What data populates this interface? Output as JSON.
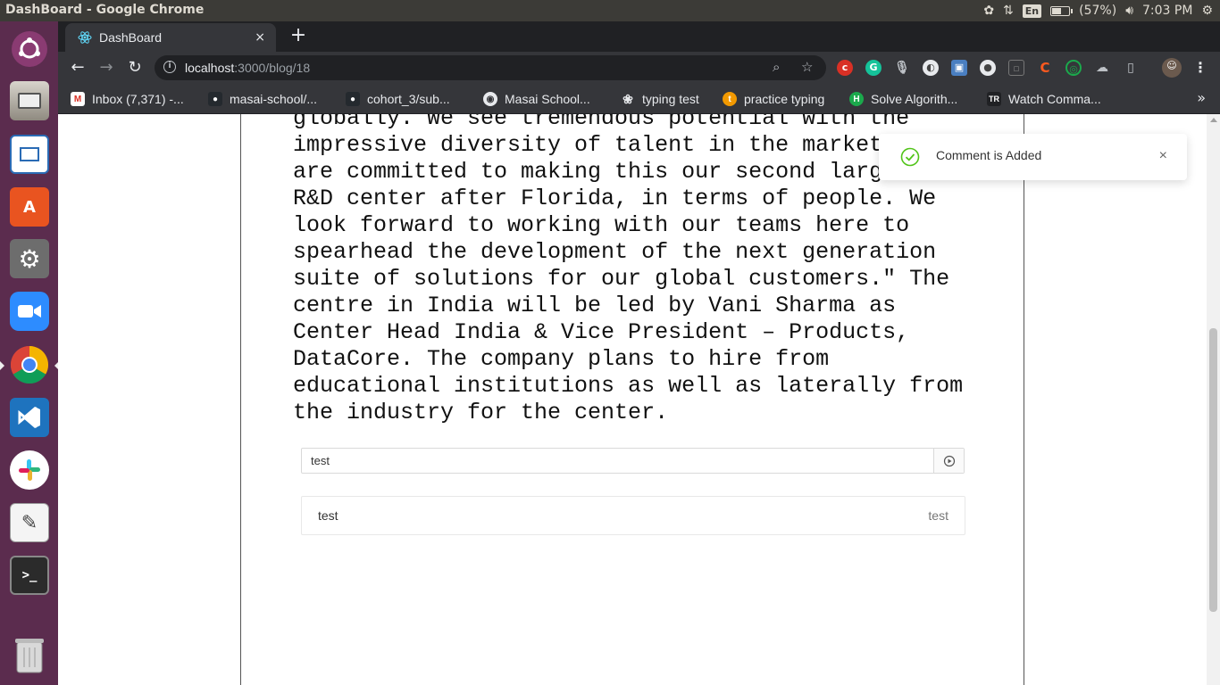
{
  "system": {
    "window_title": "DashBoard - Google Chrome",
    "keyboard_layout": "En",
    "battery_text": "(57%)",
    "battery_level": 0.57,
    "clock": "7:03 PM"
  },
  "launcher": {
    "apps": [
      "ubuntu-dash",
      "file-manager",
      "libreoffice-writer",
      "ubuntu-software",
      "system-settings",
      "zoom",
      "google-chrome",
      "vscode",
      "slack",
      "text-editor",
      "terminal",
      "trash"
    ]
  },
  "browser": {
    "tab_title": "DashBoard",
    "tab_close": "×",
    "new_tab": "+",
    "url_host": "localhost",
    "url_path": ":3000/blog/18",
    "bookmarks": [
      {
        "label": "Inbox (7,371) -...",
        "icon": "gmail-icon",
        "color": "#d93025",
        "glyph": "M"
      },
      {
        "label": "masai-school/...",
        "icon": "github-icon",
        "color": "#24292e",
        "glyph": "●"
      },
      {
        "label": "cohort_3/sub...",
        "icon": "github-icon",
        "color": "#24292e",
        "glyph": "●"
      },
      {
        "label": "Masai School...",
        "icon": "globe-icon",
        "color": "#5f6368",
        "glyph": "◉"
      },
      {
        "label": "typing test",
        "icon": "paw-icon",
        "color": "#202124",
        "glyph": "❀"
      },
      {
        "label": "practice typing",
        "icon": "typing-icon",
        "color": "#f29900",
        "glyph": "t"
      },
      {
        "label": "Solve Algorith...",
        "icon": "hackerrank-icon",
        "color": "#1ba94c",
        "glyph": "H"
      },
      {
        "label": "Watch Comma...",
        "icon": "tr-icon",
        "color": "#202124",
        "glyph": "TR"
      }
    ],
    "bookmarks_overflow": "»"
  },
  "page": {
    "article_lines": [
      "globally. We see tremendous potential with the",
      "impressive diversity of talent in the market",
      "are committed to making this our second larg",
      "R&D center after Florida, in terms of people. We",
      "look forward to working with our teams here to",
      "spearhead the development of the next generation",
      "suite of solutions for our global customers.\" The",
      "centre in India will be led by Vani Sharma as",
      "Center Head India & Vice President – Products,",
      "DataCore. The company plans to hire from",
      "educational institutions as well as laterally from",
      "the industry for the center."
    ],
    "comment_input_value": "test",
    "comments": [
      {
        "text": "test",
        "author": "test"
      }
    ]
  },
  "toast": {
    "message": "Comment is Added",
    "close": "×",
    "status_color": "#52c41a"
  }
}
